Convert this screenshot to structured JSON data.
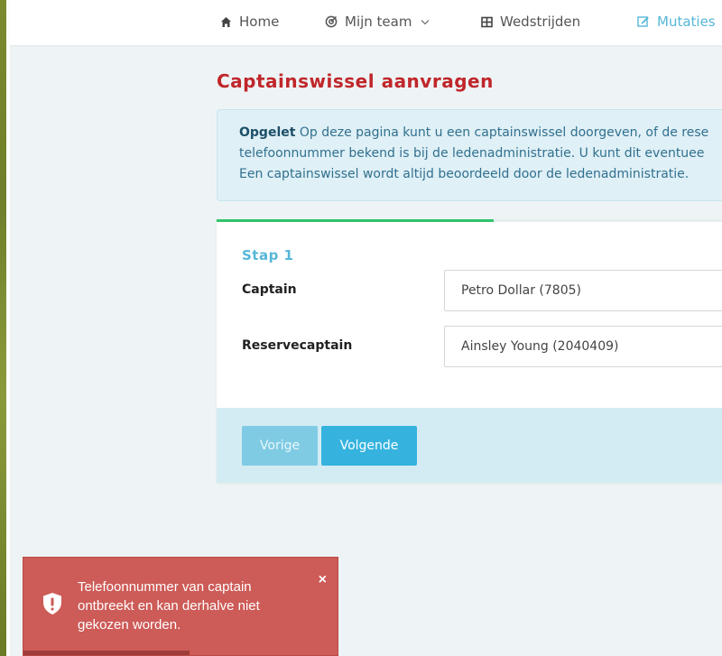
{
  "nav": {
    "items": [
      {
        "label": "Home",
        "icon": "home-icon"
      },
      {
        "label": "Mijn team",
        "icon": "target-icon",
        "dropdown": true
      },
      {
        "label": "Wedstrijden",
        "icon": "grid-icon"
      },
      {
        "label": "Mutaties",
        "icon": "edit-icon",
        "active": true
      }
    ],
    "active_color": "#56b7d8"
  },
  "page": {
    "title": "Captainswissel aanvragen"
  },
  "alert": {
    "bold": "Opgelet",
    "line1": " Op deze pagina kunt u een captainswissel doorgeven, of de rese",
    "line2": "telefoonnummer bekend is bij de ledenadministratie. U kunt dit eventuee",
    "line3": "Een captainswissel wordt altijd beoordeeld door de ledenadministratie."
  },
  "wizard": {
    "progress_fraction": 0.53,
    "step_title": "Stap 1",
    "fields": [
      {
        "label": "Captain",
        "value": "Petro Dollar (7805)"
      },
      {
        "label": "Reservecaptain",
        "value": "Ainsley Young (2040409)"
      }
    ],
    "prev_label": "Vorige",
    "next_label": "Volgende"
  },
  "toast": {
    "message": "Telefoonnummer van captain ontbreekt en kan derhalve niet gekozen worden.",
    "close_glyph": "×",
    "icon": "shield-exclamation-icon",
    "color": "#cd5b57"
  }
}
